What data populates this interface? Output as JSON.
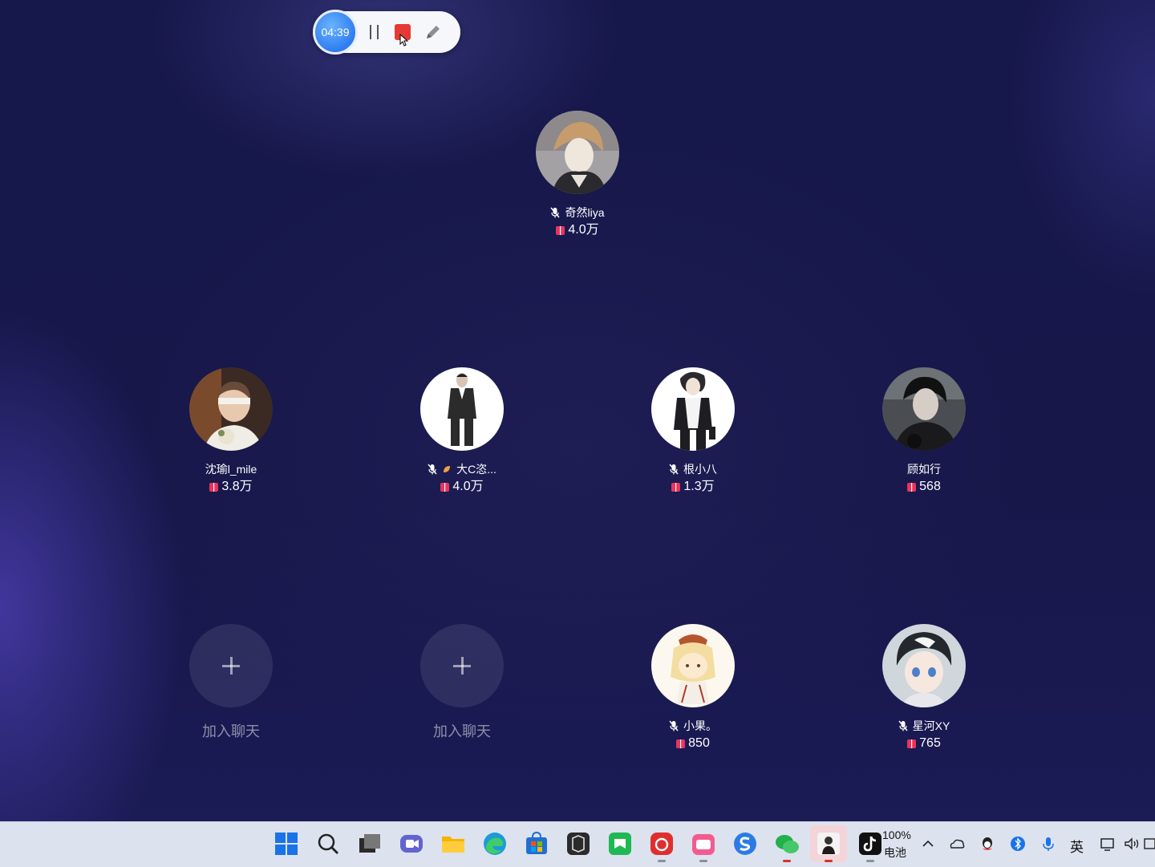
{
  "recorder": {
    "timer": "04:39"
  },
  "host": {
    "name": "奇然liya",
    "score": "4.0万"
  },
  "seats": [
    {
      "name": "沈瑜l_mile",
      "score": "3.8万"
    },
    {
      "name": "大C恣...",
      "score": "4.0万"
    },
    {
      "name": "根小八",
      "score": "1.3万"
    },
    {
      "name": "顾如行",
      "score": "568"
    }
  ],
  "bottom_seats": [
    {
      "join_label": "加入聊天"
    },
    {
      "join_label": "加入聊天"
    },
    {
      "name": "小果。",
      "score": "850"
    },
    {
      "name": "星河XY",
      "score": "765"
    }
  ],
  "taskbar": {
    "apps": [
      "windows-start-icon",
      "search-icon",
      "task-view-icon",
      "meet-icon",
      "file-explorer-icon",
      "edge-icon",
      "store-icon",
      "terminal-icon",
      "green-app-icon",
      "netease-music-icon",
      "bilibili-icon",
      "sogou-icon",
      "wechat-icon",
      "live-app-icon",
      "tiktok-icon"
    ],
    "battery_percent": "100%",
    "battery_label": "电池",
    "ime": "英"
  },
  "colors": {
    "accent": "#2f7df0",
    "stop": "#e53935",
    "gift": "#e8345c",
    "background": "#161748"
  }
}
